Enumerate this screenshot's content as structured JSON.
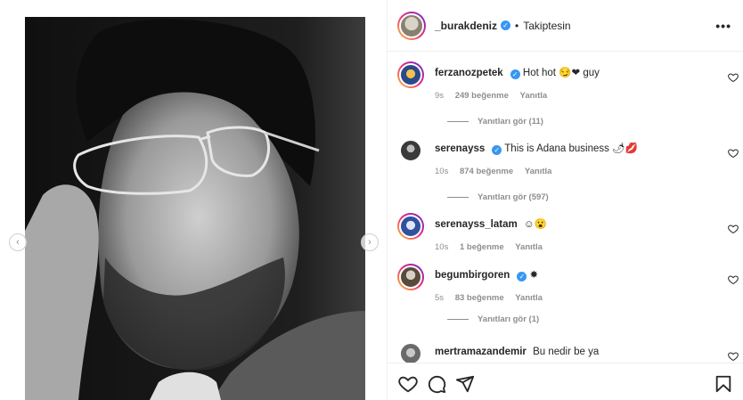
{
  "header": {
    "username": "_burakdeniz",
    "verified_mark": "✓",
    "separator": "•",
    "follow_state": "Takiptesin",
    "more_icon": "•••"
  },
  "media": {
    "nav_left": "‹",
    "nav_right": "›"
  },
  "comments": [
    {
      "username": "ferzanozpetek",
      "verified": true,
      "text": "Hot hot 😏❤ guy",
      "time": "9s",
      "likes": "249 beğenme",
      "reply_label": "Yanıtla",
      "view_replies": "Yanıtları gör (11)"
    },
    {
      "username": "serenayss",
      "verified": true,
      "text": "This is Adana business 🌶💋",
      "time": "10s",
      "likes": "874 beğenme",
      "reply_label": "Yanıtla",
      "view_replies": "Yanıtları gör (597)"
    },
    {
      "username": "serenayss_latam",
      "verified": false,
      "text": "☺😮",
      "time": "10s",
      "likes": "1 beğenme",
      "reply_label": "Yanıtla",
      "view_replies": ""
    },
    {
      "username": "begumbirgoren",
      "verified": true,
      "text": "✸",
      "time": "5s",
      "likes": "83 beğenme",
      "reply_label": "Yanıtla",
      "view_replies": "Yanıtları gör (1)"
    },
    {
      "username": "mertramazandemir",
      "verified": false,
      "text": "Bu nedir be ya",
      "time": "",
      "likes": "",
      "reply_label": "",
      "view_replies": ""
    }
  ],
  "icons": {
    "like": "heart-icon",
    "comment": "comment-icon",
    "share": "send-icon",
    "save": "bookmark-icon"
  },
  "colors": {
    "verified": "#3897f0",
    "muted_text": "#8e8e8e",
    "primary_text": "#262626",
    "border": "#efefef"
  }
}
